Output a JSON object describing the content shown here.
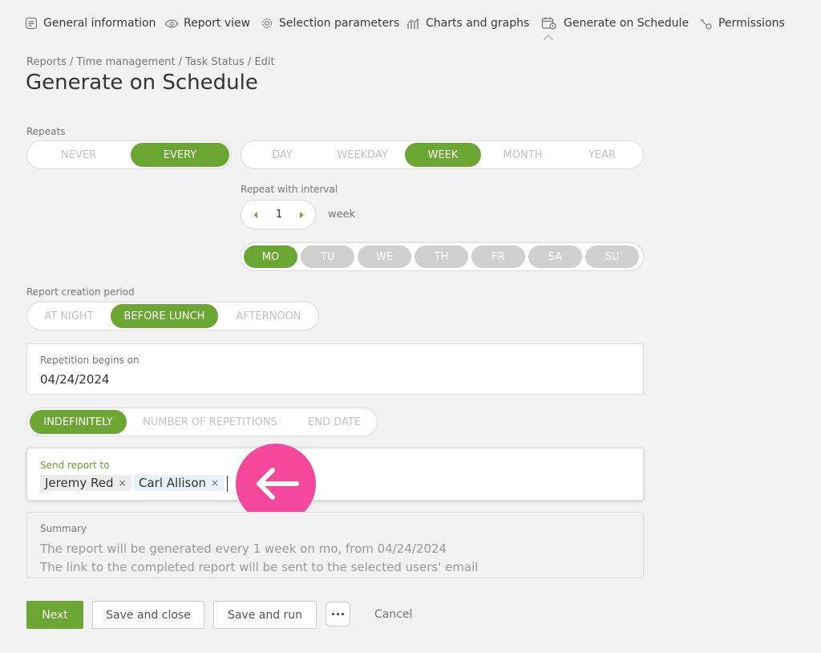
{
  "nav": {
    "items": [
      {
        "label": "General information",
        "icon": "document-lines-icon"
      },
      {
        "label": "Report view",
        "icon": "eye-icon"
      },
      {
        "label": "Selection parameters",
        "icon": "gear-icon"
      },
      {
        "label": "Charts and graphs",
        "icon": "chart-icon"
      },
      {
        "label": "Generate on Schedule",
        "icon": "calendar-clock-icon",
        "active": true
      },
      {
        "label": "Permissions",
        "icon": "key-icon"
      }
    ]
  },
  "breadcrumb": "Reports / Time management / Task Status / Edit",
  "title": "Generate on Schedule",
  "repeats": {
    "label": "Repeats",
    "mode_options": [
      "NEVER",
      "EVERY"
    ],
    "mode_selected": "EVERY",
    "unit_options": [
      "DAY",
      "WEEKDAY",
      "WEEK",
      "MONTH",
      "YEAR"
    ],
    "unit_selected": "WEEK"
  },
  "interval": {
    "label": "Repeat with interval",
    "value": "1",
    "unit": "week"
  },
  "days": {
    "options": [
      "MO",
      "TU",
      "WE",
      "TH",
      "FR",
      "SA",
      "SU"
    ],
    "selected": [
      "MO"
    ]
  },
  "creation_period": {
    "label": "Report creation period",
    "options": [
      "AT NIGHT",
      "BEFORE LUNCH",
      "AFTERNOON"
    ],
    "selected": "BEFORE LUNCH"
  },
  "begins": {
    "label": "Repetition begins on",
    "value": "04/24/2024"
  },
  "end": {
    "options": [
      "INDEFINITELY",
      "NUMBER OF REPETITIONS",
      "END DATE"
    ],
    "selected": "INDEFINITELY"
  },
  "send_to": {
    "label": "Send report to",
    "recipients": [
      {
        "name": "Jeremy Red",
        "remove": "×"
      },
      {
        "name": "Carl Allison",
        "remove": "×"
      }
    ]
  },
  "summary": {
    "label": "Summary",
    "line1": "The report will be generated every 1 week on mo, from 04/24/2024",
    "line2": "The link to the completed report will be sent to the selected users' email"
  },
  "actions": {
    "next": "Next",
    "save_close": "Save and close",
    "save_run": "Save and run",
    "cancel": "Cancel"
  },
  "colors": {
    "accent": "#6aa631",
    "pointer": "#f5489d",
    "chip_1": "#ececec",
    "chip_2": "#e5f3f8"
  }
}
